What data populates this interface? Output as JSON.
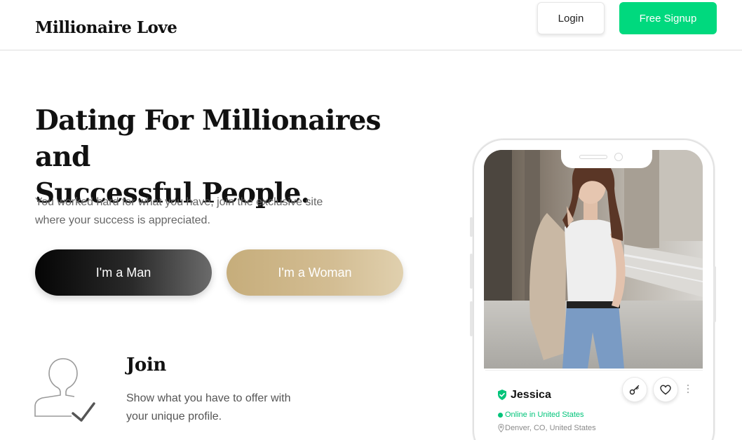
{
  "header": {
    "logo": "Millionaire Love",
    "login_label": "Login",
    "signup_label": "Free Signup"
  },
  "hero": {
    "title_line1": "Dating For Millionaires and",
    "title_line2": "Successful People.",
    "subtitle_line1": "You worked hard for what you have, join the exclusive site",
    "subtitle_line2": "where your success is appreciated.",
    "man_label": "I'm a Man",
    "woman_label": "I'm a Woman"
  },
  "join": {
    "title": "Join",
    "text_line1": "Show what you have to offer with",
    "text_line2": "your unique profile."
  },
  "profile": {
    "name": "Jessica",
    "status": "Online in United States",
    "location": "Denver, CO, United States"
  },
  "colors": {
    "accent_green": "#00d97e",
    "gold": "#c6ad7b",
    "online_green": "#00c47a"
  },
  "icons": [
    "user-check-icon",
    "key-icon",
    "heart-icon",
    "verified-shield-icon",
    "location-pin-icon",
    "more-vertical-icon"
  ]
}
